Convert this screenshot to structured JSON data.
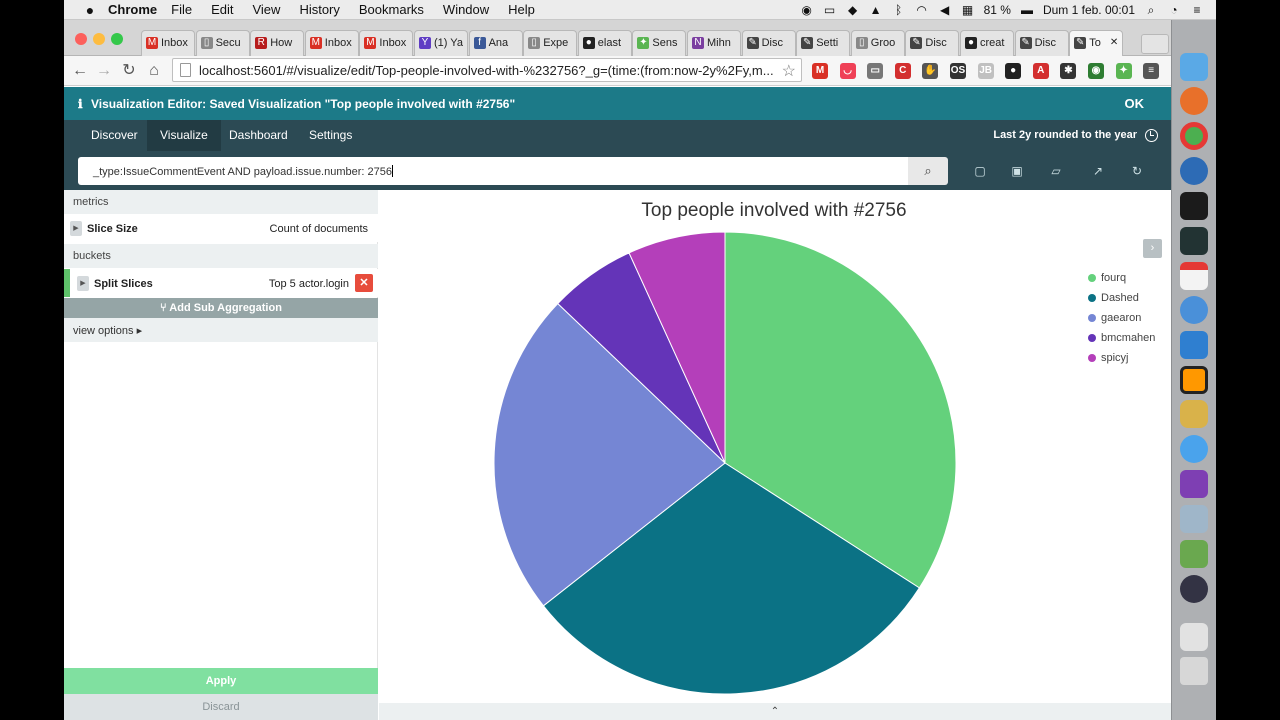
{
  "menubar": {
    "app": "Chrome",
    "items": [
      "File",
      "Edit",
      "View",
      "History",
      "Bookmarks",
      "Window",
      "Help"
    ],
    "battery": "81 %",
    "datetime": "Dum 1 feb.  00:01"
  },
  "browser": {
    "tabs": [
      {
        "label": "Inbox",
        "icon": "gmail-icon",
        "color": "#d93025",
        "glyph": "M"
      },
      {
        "label": "Secu",
        "icon": "page-icon",
        "color": "#888888",
        "glyph": "▯"
      },
      {
        "label": "How",
        "icon": "site-icon",
        "color": "#b71c1c",
        "glyph": "R"
      },
      {
        "label": "Inbox",
        "icon": "gmail-icon",
        "color": "#d93025",
        "glyph": "M"
      },
      {
        "label": "Inbox",
        "icon": "gmail-icon",
        "color": "#d93025",
        "glyph": "M"
      },
      {
        "label": "(1) Ya",
        "icon": "yahoo-icon",
        "color": "#5f3dc4",
        "glyph": "Y"
      },
      {
        "label": "Ana",
        "icon": "facebook-icon",
        "color": "#3b5998",
        "glyph": "f"
      },
      {
        "label": "Expe",
        "icon": "page-icon",
        "color": "#888888",
        "glyph": "▯"
      },
      {
        "label": "elast",
        "icon": "github-icon",
        "color": "#222222",
        "glyph": "●"
      },
      {
        "label": "Sens",
        "icon": "sense-icon",
        "color": "#5ab552",
        "glyph": "✦"
      },
      {
        "label": "Mihn",
        "icon": "onenote-icon",
        "color": "#7b3fa0",
        "glyph": "N"
      },
      {
        "label": "Disc",
        "icon": "kibana-icon",
        "color": "#444444",
        "glyph": "✎"
      },
      {
        "label": "Setti",
        "icon": "kibana-icon",
        "color": "#444444",
        "glyph": "✎"
      },
      {
        "label": "Groo",
        "icon": "page-icon",
        "color": "#888888",
        "glyph": "▯"
      },
      {
        "label": "Disc",
        "icon": "kibana-icon",
        "color": "#444444",
        "glyph": "✎"
      },
      {
        "label": "creat",
        "icon": "github-icon",
        "color": "#222222",
        "glyph": "●"
      },
      {
        "label": "Disc",
        "icon": "kibana-icon",
        "color": "#444444",
        "glyph": "✎"
      },
      {
        "label": "To",
        "icon": "kibana-icon",
        "color": "#444444",
        "glyph": "✎"
      }
    ],
    "active_tab_close": "✕",
    "url": "localhost:5601/#/visualize/edit/Top-people-involved-with-%232756?_g=(time:(from:now-2y%2Fy,m...",
    "extensions": [
      {
        "icon": "gmail-ext-icon",
        "color": "#d93025",
        "glyph": "M"
      },
      {
        "icon": "pocket-icon",
        "color": "#ef4056",
        "glyph": "◡"
      },
      {
        "icon": "cast-icon",
        "color": "#777777",
        "glyph": "▭"
      },
      {
        "icon": "cors-icon",
        "color": "#d32f2f",
        "glyph": "C"
      },
      {
        "icon": "evernote-icon",
        "color": "#555555",
        "glyph": "✋"
      },
      {
        "icon": "os-icon",
        "color": "#333333",
        "glyph": "OS"
      },
      {
        "icon": "jb-icon",
        "color": "#c0c0c0",
        "glyph": "JB"
      },
      {
        "icon": "github-ext-icon",
        "color": "#222222",
        "glyph": "●"
      },
      {
        "icon": "adblock-icon",
        "color": "#d32f2f",
        "glyph": "A"
      },
      {
        "icon": "puzzle-icon",
        "color": "#333333",
        "glyph": "✱"
      },
      {
        "icon": "speed-icon",
        "color": "#2e7d32",
        "glyph": "◉"
      },
      {
        "icon": "sense-ext-icon",
        "color": "#5ab552",
        "glyph": "✦"
      },
      {
        "icon": "menu-icon",
        "color": "#555555",
        "glyph": "≡"
      }
    ]
  },
  "kibana": {
    "notice": "Visualization Editor: Saved Visualization \"Top people involved with #2756\"",
    "notice_ok": "OK",
    "nav": [
      "Discover",
      "Visualize",
      "Dashboard",
      "Settings"
    ],
    "nav_active": "Visualize",
    "time_range": "Last 2y rounded to the year",
    "query": "_type:IssueCommentEvent AND payload.issue.number: 2756",
    "sidebar": {
      "metrics_header": "metrics",
      "metric": {
        "name": "Slice Size",
        "value": "Count of documents"
      },
      "buckets_header": "buckets",
      "bucket": {
        "name": "Split Slices",
        "value": "Top 5 actor.login",
        "remove": "✕"
      },
      "add_sub": "⑂ Add Sub Aggregation",
      "view_options": "view options ▸",
      "apply": "Apply",
      "discard": "Discard"
    },
    "legend_toggle": "›",
    "bottom_toggle": "⌃"
  },
  "colors": {
    "accent": "#1c7a88",
    "nav": "#2c4a54",
    "apply": "#80e0a0",
    "remove": "#e74c3c"
  },
  "chart_data": {
    "type": "pie",
    "title": "Top people involved with #2756",
    "categories": [
      "fourq",
      "Dashed",
      "gaearon",
      "bmcmahen",
      "spicyj"
    ],
    "values": [
      9,
      8,
      6,
      1.6,
      1.8
    ],
    "colors": [
      "#64d17c",
      "#0b7285",
      "#7586d4",
      "#6434b8",
      "#b43fba"
    ],
    "legend_position": "right"
  }
}
